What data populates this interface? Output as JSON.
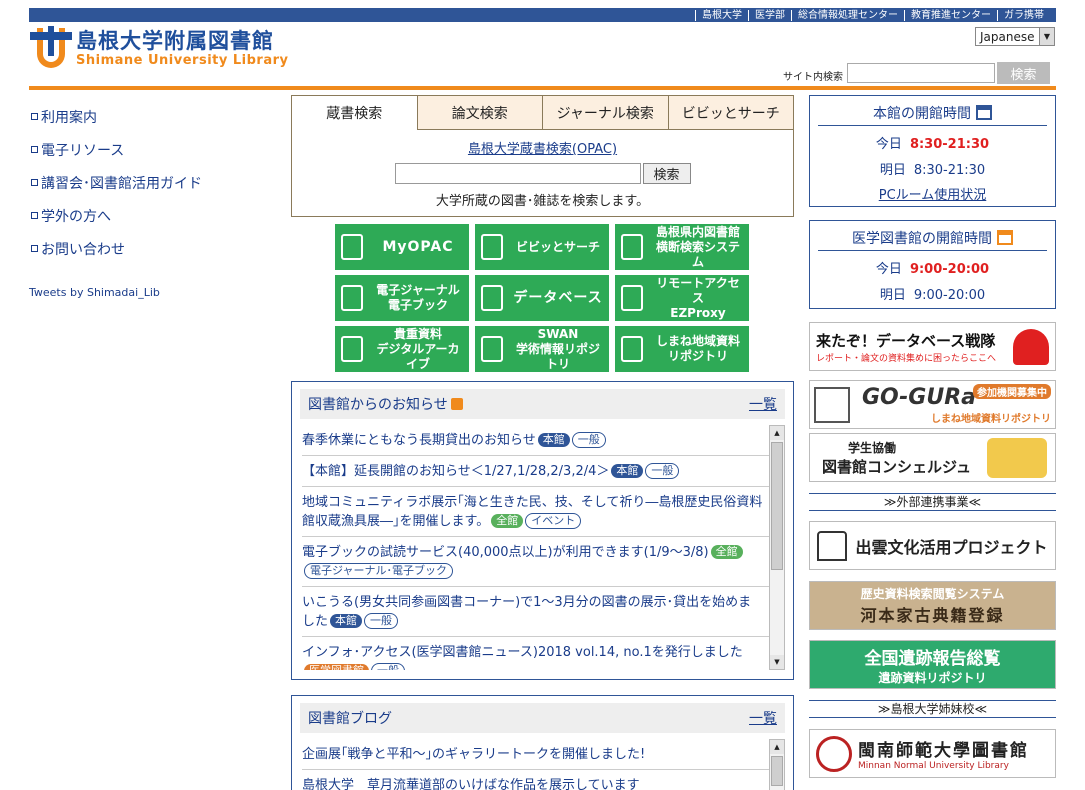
{
  "header": {
    "topnav": [
      "島根大学",
      "医学部",
      "総合情報処理センター",
      "教育推進センター",
      "ガラ携帯"
    ],
    "logo_jp": "島根大学附属図書館",
    "logo_en": "Shimane University Library",
    "language": "Japanese",
    "site_search_label": "サイト内検索",
    "site_search_button": "検索"
  },
  "leftnav": [
    "利用案内",
    "電子リソース",
    "講習会･図書館活用ガイド",
    "学外の方へ",
    "お問い合わせ"
  ],
  "tweets_link": "Tweets by Shimadai_Lib",
  "search": {
    "tabs": [
      "蔵書検索",
      "論文検索",
      "ジャーナル検索",
      "ビビッとサーチ"
    ],
    "opac_link": "島根大学蔵書検索(OPAC)",
    "button": "検索",
    "note": "大学所蔵の図書･雑誌を検索します。"
  },
  "tiles": [
    {
      "label1": "MyOPAC",
      "label2": ""
    },
    {
      "label1": "ビビッとサーチ",
      "label2": ""
    },
    {
      "label1": "島根県内図書館",
      "label2": "横断検索システム"
    },
    {
      "label1": "電子ジャーナル",
      "label2": "電子ブック"
    },
    {
      "label1": "データベース",
      "label2": ""
    },
    {
      "label1": "リモートアクセス",
      "label2": "EZProxy"
    },
    {
      "label1": "貴重資料",
      "label2": "デジタルアーカイブ"
    },
    {
      "label1": "SWAN",
      "label2": "学術情報リポジトリ"
    },
    {
      "label1": "しまね地域資料",
      "label2": "リポジトリ"
    }
  ],
  "news": {
    "title": "図書館からのお知らせ",
    "more": "一覧",
    "items": [
      {
        "text": "春季休業にともなう長期貸出のお知らせ",
        "tags": [
          {
            "label": "本館",
            "style": "b-blue"
          },
          {
            "label": "一般",
            "style": "b-out"
          }
        ]
      },
      {
        "text": "【本館】延長開館のお知らせ＜1/27,1/28,2/3,2/4＞",
        "tags": [
          {
            "label": "本館",
            "style": "b-blue"
          },
          {
            "label": "一般",
            "style": "b-out"
          }
        ]
      },
      {
        "text": "地域コミュニティラボ展示｢海と生きた民、技、そして祈り―島根歴史民俗資料館収蔵漁具展―｣を開催します。",
        "tags": [
          {
            "label": "全館",
            "style": "b-green"
          },
          {
            "label": "イベント",
            "style": "b-out"
          }
        ]
      },
      {
        "text": "電子ブックの試読サービス(40,000点以上)が利用できます(1/9～3/8)",
        "tags": [
          {
            "label": "全館",
            "style": "b-green"
          },
          {
            "label": "電子ジャーナル･電子ブック",
            "style": "b-out"
          }
        ]
      },
      {
        "text": "いこうる(男女共同参画図書コーナー)で1～3月分の図書の展示･貸出を始めました",
        "tags": [
          {
            "label": "本館",
            "style": "b-blue"
          },
          {
            "label": "一般",
            "style": "b-out"
          }
        ]
      },
      {
        "text": "インフォ･アクセス(医学図書館ニュース)2018 vol.14, no.1を発行しました",
        "tags": [
          {
            "label": "医学図書館",
            "style": "b-orange"
          },
          {
            "label": "一般",
            "style": "b-out"
          }
        ]
      }
    ]
  },
  "blog": {
    "title": "図書館ブログ",
    "more": "一覧",
    "items": [
      {
        "text": "企画展｢戦争と平和～｣のギャラリートークを開催しました!"
      },
      {
        "text": "島根大学　草月流華道部のいけばな作品を展示しています"
      }
    ]
  },
  "main_hours": {
    "title": "本館の開館時間",
    "today_label": "今日",
    "today": "8:30-21:30",
    "tomorrow_label": "明日",
    "tomorrow": "8:30-21:30",
    "pc_link": "PCルーム使用状況"
  },
  "med_hours": {
    "title": "医学図書館の開館時間",
    "today_label": "今日",
    "today": "9:00-20:00",
    "tomorrow_label": "明日",
    "tomorrow": "9:00-20:00"
  },
  "banners": {
    "db_title": "来たぞ！データベース戦隊",
    "db_sub": "レポート・論文の資料集めに困ったらここへ",
    "gogura": "GO-GURa",
    "gogura_badge": "参加機関募集中",
    "gogura_sub": "しまね地域資料リポジトリ",
    "concierge1": "学生協働",
    "concierge2": "図書館コンシェルジュ",
    "section_external": "≫外部連携事業≪",
    "izumo": "出雲文化活用プロジェクト",
    "kawamoto1": "歴史資料検索閲覧システム",
    "kawamoto2": "河本家古典籍登録",
    "iseki1": "全国遺跡報告総覧",
    "iseki2": "遺跡資料リポジトリ",
    "section_sister": "≫島根大学姉妹校≪",
    "minnan1": "閩南師範大學圖書館",
    "minnan2": "Minnan Normal University Library"
  }
}
